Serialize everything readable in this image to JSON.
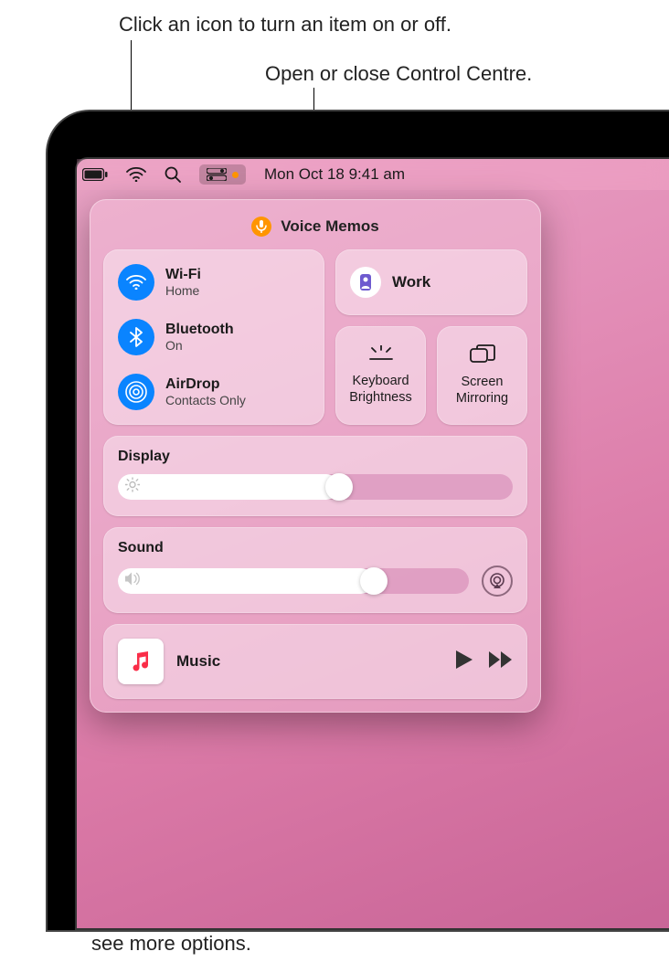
{
  "callouts": {
    "toggle": "Click an icon to turn an item on or off.",
    "open_close": "Open or close Control Centre.",
    "more_options": "For some controls, click anywhere to see more options."
  },
  "menubar": {
    "datetime": "Mon Oct 18  9:41 am"
  },
  "control_centre": {
    "voice_memos_label": "Voice Memos",
    "wifi": {
      "title": "Wi-Fi",
      "subtitle": "Home"
    },
    "bluetooth": {
      "title": "Bluetooth",
      "subtitle": "On"
    },
    "airdrop": {
      "title": "AirDrop",
      "subtitle": "Contacts Only"
    },
    "focus": {
      "label": "Work"
    },
    "keyboard_brightness": "Keyboard Brightness",
    "screen_mirroring": "Screen Mirroring",
    "display": {
      "title": "Display",
      "value_pct": 56
    },
    "sound": {
      "title": "Sound",
      "value_pct": 73
    },
    "music": {
      "title": "Music"
    }
  }
}
